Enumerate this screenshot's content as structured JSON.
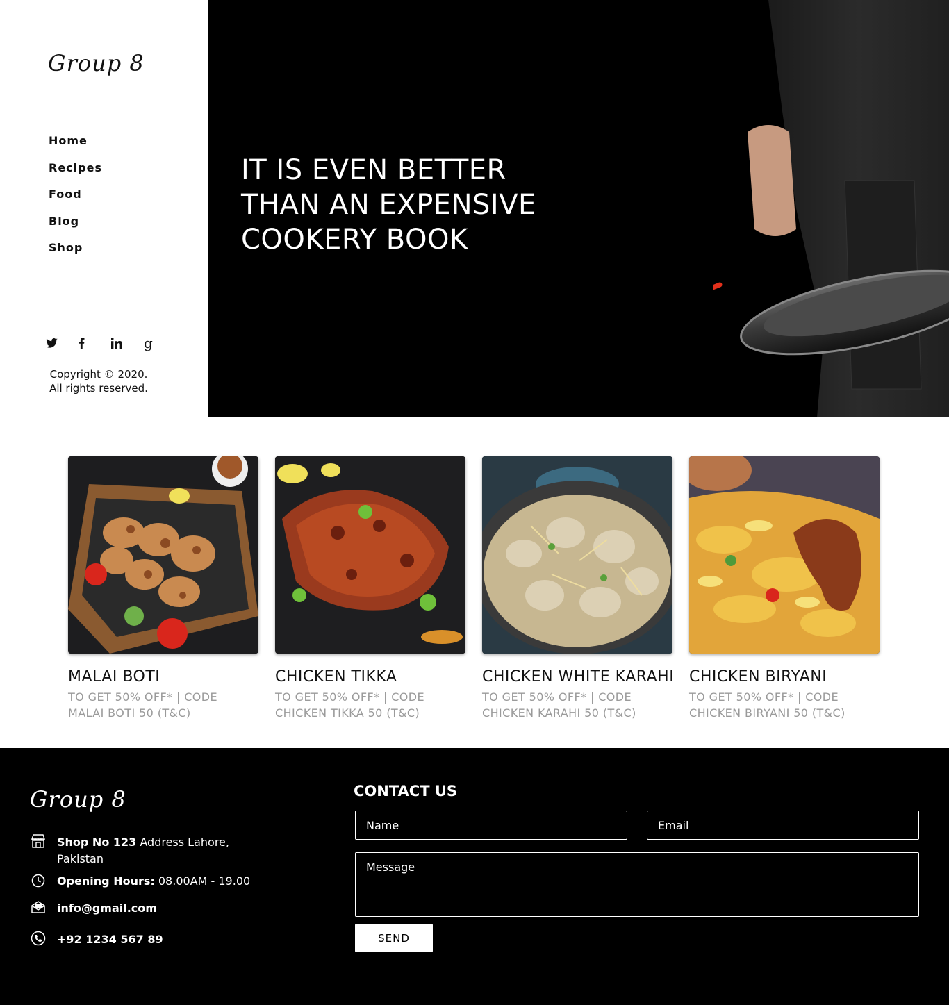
{
  "sidebar": {
    "logo": "Group 8",
    "nav": [
      "Home",
      "Recipes",
      "Food",
      "Blog",
      "Shop"
    ],
    "socials": [
      "twitter-icon",
      "facebook-icon",
      "linkedin-icon",
      "google-icon"
    ],
    "copyright_line1": "Copyright © 2020.",
    "copyright_line2": "All rights reserved."
  },
  "hero": {
    "line1": "IT IS EVEN BETTER",
    "line2": "THAN AN EXPENSIVE",
    "line3": "COOKERY BOOK"
  },
  "cards": [
    {
      "name": "MALAI BOTI",
      "promo1": "TO GET 50% OFF* | CODE",
      "promo2": "MALAI BOTI 50 (T&C)"
    },
    {
      "name": "CHICKEN TIKKA",
      "promo1": "TO GET 50% OFF* | CODE",
      "promo2": "CHICKEN TIKKA 50 (T&C)"
    },
    {
      "name": "CHICKEN WHITE KARAHI",
      "promo1": "TO GET 50% OFF* | CODE",
      "promo2": "CHICKEN KARAHI 50 (T&C)"
    },
    {
      "name": "CHICKEN BIRYANI",
      "promo1": "TO GET 50% OFF* | CODE",
      "promo2": "CHICKEN BIRYANI 50 (T&C)"
    }
  ],
  "footer": {
    "logo": "Group 8",
    "address_bold": "Shop No 123",
    "address_rest": " Address Lahore, Pakistan",
    "hours_bold": "Opening Hours:",
    "hours_rest": " 08.00AM - 19.00",
    "email": "info@gmail.com",
    "phone": "+92 1234 567 89",
    "contact_title": "CONTACT US",
    "name_placeholder": "Name",
    "email_placeholder": "Email",
    "message_placeholder": "Message",
    "send_label": "SEND"
  }
}
